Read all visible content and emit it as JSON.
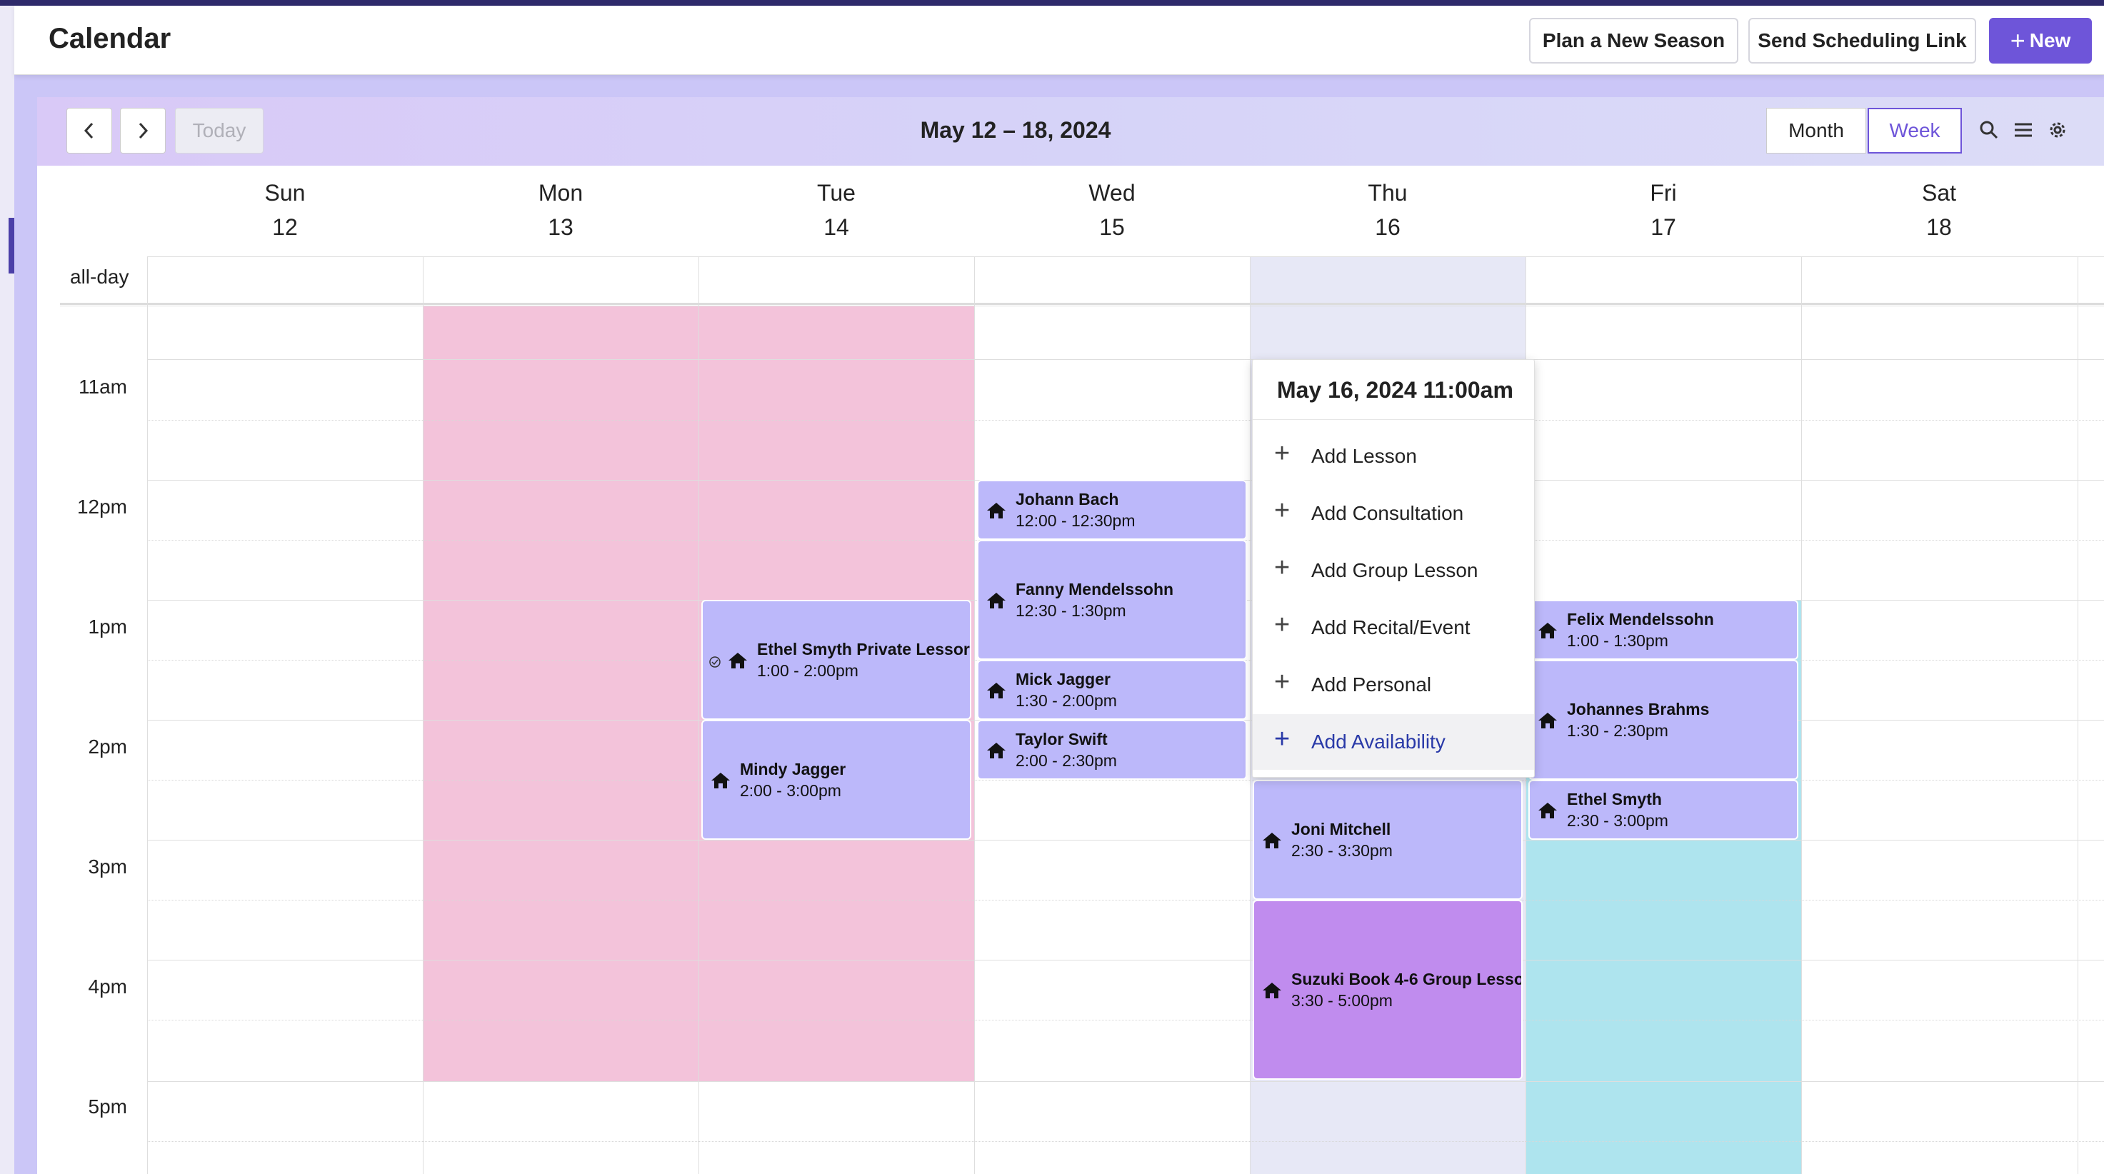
{
  "header": {
    "title": "Calendar",
    "plan_label": "Plan a New Season",
    "link_label": "Send Scheduling Link",
    "new_plus": "+",
    "new_label": "New"
  },
  "toolbar": {
    "today_label": "Today",
    "range_title": "May 12 – 18, 2024",
    "month_label": "Month",
    "week_label": "Week",
    "active_view": "Week",
    "icons": [
      "chevron-left-icon",
      "chevron-right-icon",
      "search-icon",
      "list-icon",
      "gear-icon"
    ]
  },
  "days": [
    {
      "name": "Sun",
      "date": "12"
    },
    {
      "name": "Mon",
      "date": "13"
    },
    {
      "name": "Tue",
      "date": "14"
    },
    {
      "name": "Wed",
      "date": "15"
    },
    {
      "name": "Thu",
      "date": "16"
    },
    {
      "name": "Fri",
      "date": "17"
    },
    {
      "name": "Sat",
      "date": "18"
    }
  ],
  "allday_label": "all-day",
  "times": [
    "11am",
    "12pm",
    "1pm",
    "2pm",
    "3pm",
    "4pm",
    "5pm"
  ],
  "colors": {
    "accent": "#6e55d9",
    "unavailable_pink": "#f3c3da",
    "today_column": "#e7e8f6",
    "fri_availability": "#aee4ee",
    "event": "#bcb8fa",
    "group_event": "#c08cee"
  },
  "events": [
    {
      "name": "Johann Bach",
      "time": "12:00 - 12:30pm"
    },
    {
      "name": "Fanny Mendelssohn",
      "time": "12:30 - 1:30pm"
    },
    {
      "name": "Mick Jagger",
      "time": "1:30 - 2:00pm"
    },
    {
      "name": "Taylor Swift",
      "time": "2:00 - 2:30pm"
    },
    {
      "name": "Ethel Smyth Private Lessor",
      "time": "1:00 - 2:00pm"
    },
    {
      "name": "Mindy Jagger",
      "time": "2:00 - 3:00pm"
    },
    {
      "name": "Felix Mendelssohn",
      "time": "1:00 - 1:30pm"
    },
    {
      "name": "Johannes Brahms",
      "time": "1:30 - 2:30pm"
    },
    {
      "name": "Ethel Smyth",
      "time": "2:30 - 3:00pm"
    },
    {
      "name": "Joni Mitchell",
      "time": "2:30 - 3:30pm"
    },
    {
      "name": "Suzuki Book 4-6 Group Lesso",
      "time": "3:30 - 5:00pm"
    }
  ],
  "popup": {
    "title": "May 16, 2024 11:00am",
    "items": [
      "Add Lesson",
      "Add Consultation",
      "Add Group Lesson",
      "Add Recital/Event",
      "Add Personal",
      "Add Availability"
    ]
  }
}
